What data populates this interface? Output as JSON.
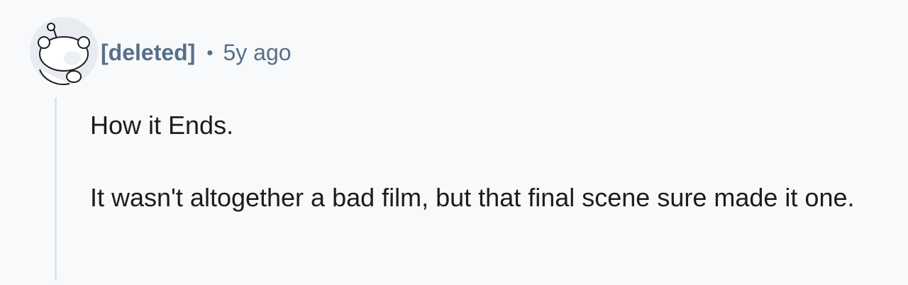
{
  "comment": {
    "author": "[deleted]",
    "separator": "•",
    "timestamp": "5y ago",
    "paragraphs": [
      "How it Ends.",
      "It wasn't altogether a bad film, but that final scene sure made it one."
    ]
  },
  "colors": {
    "meta": "#576f89",
    "text": "#1c1c1c",
    "background": "#f8f9fb",
    "thread_line": "#dfe4ea"
  },
  "icons": {
    "avatar": "reddit-snoo-avatar-icon"
  }
}
